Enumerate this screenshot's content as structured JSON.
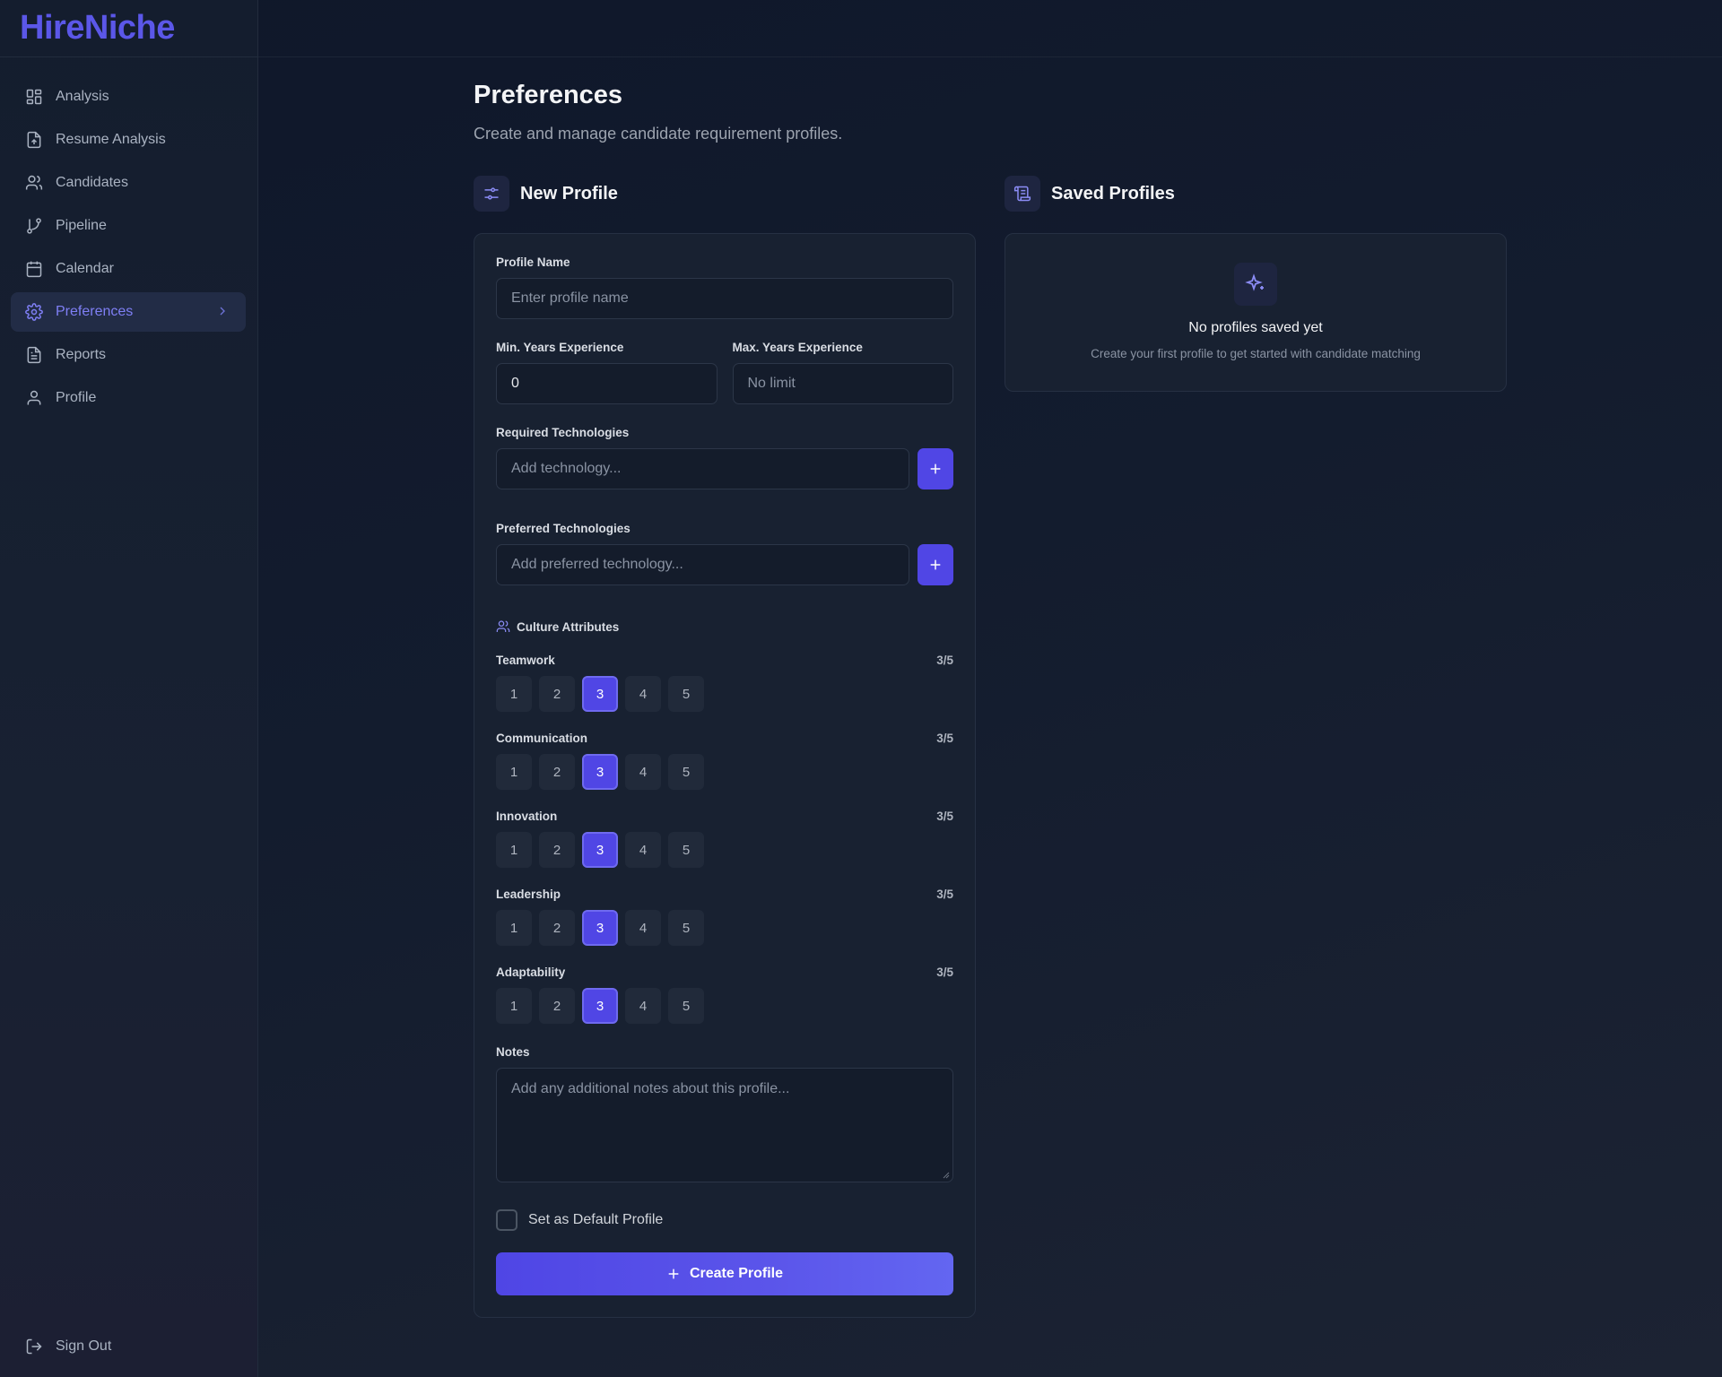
{
  "app": {
    "brand": "HireNiche"
  },
  "sidebar": {
    "items": [
      {
        "label": "Analysis",
        "icon": "layout-grid-icon"
      },
      {
        "label": "Resume Analysis",
        "icon": "file-upload-icon"
      },
      {
        "label": "Candidates",
        "icon": "users-icon"
      },
      {
        "label": "Pipeline",
        "icon": "git-branch-icon"
      },
      {
        "label": "Calendar",
        "icon": "calendar-icon"
      },
      {
        "label": "Preferences",
        "icon": "gear-icon",
        "active": true
      },
      {
        "label": "Reports",
        "icon": "file-text-icon"
      },
      {
        "label": "Profile",
        "icon": "user-icon"
      }
    ],
    "signout": "Sign Out"
  },
  "page": {
    "title": "Preferences",
    "subtitle": "Create and manage candidate requirement profiles."
  },
  "new_profile": {
    "heading": "New Profile",
    "profile_name_label": "Profile Name",
    "profile_name_placeholder": "Enter profile name",
    "min_exp_label": "Min. Years Experience",
    "min_exp_value": "0",
    "max_exp_label": "Max. Years Experience",
    "max_exp_placeholder": "No limit",
    "required_tech_label": "Required Technologies",
    "required_tech_placeholder": "Add technology...",
    "preferred_tech_label": "Preferred Technologies",
    "preferred_tech_placeholder": "Add preferred technology...",
    "culture_label": "Culture Attributes",
    "attributes": [
      {
        "name": "Teamwork",
        "score": "3/5",
        "value": 3
      },
      {
        "name": "Communication",
        "score": "3/5",
        "value": 3
      },
      {
        "name": "Innovation",
        "score": "3/5",
        "value": 3
      },
      {
        "name": "Leadership",
        "score": "3/5",
        "value": 3
      },
      {
        "name": "Adaptability",
        "score": "3/5",
        "value": 3
      }
    ],
    "rating_options": [
      "1",
      "2",
      "3",
      "4",
      "5"
    ],
    "notes_label": "Notes",
    "notes_placeholder": "Add any additional notes about this profile...",
    "default_label": "Set as Default Profile",
    "default_checked": false,
    "create_label": "Create Profile"
  },
  "saved_profiles": {
    "heading": "Saved Profiles",
    "empty_title": "No profiles saved yet",
    "empty_sub": "Create your first profile to get started with candidate matching"
  },
  "colors": {
    "accent": "#5046e5",
    "brand": "#5b57e8",
    "active_text": "#7f7ff5"
  }
}
